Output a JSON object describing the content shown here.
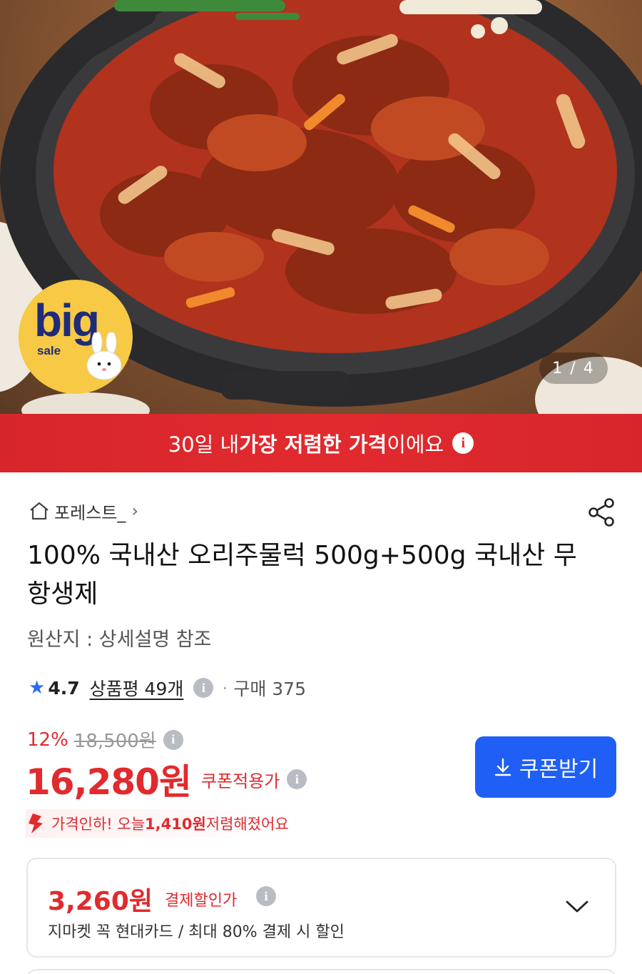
{
  "hero": {
    "counter": "1 / 4",
    "badge_big": "big",
    "badge_sale": "sale"
  },
  "banner": {
    "text_pre": "30일 내 ",
    "text_bold": "가장 저렴한 가격",
    "text_post": "이에요",
    "info": "i"
  },
  "store": {
    "name": "포레스트_",
    "chevron": "›"
  },
  "product": {
    "title": "100% 국내산 오리주물럭 500g+500g 국내산 무항생제",
    "origin": "원산지 : 상세설명 참조"
  },
  "rating": {
    "star": "★",
    "score": "4.7",
    "reviews": "상품평 49개",
    "info": "i",
    "dot": "·",
    "purchases": "구매 375"
  },
  "pricing": {
    "discount": "12%",
    "original": "18,500원",
    "info": "i",
    "price": "16,280원",
    "coupon_label": "쿠폰적용가",
    "coupon_button": "쿠폰받기",
    "drop_pre": "가격인하! 오늘 ",
    "drop_amount": "1,410원",
    "drop_post": " 저렴해졌어요"
  },
  "payment": {
    "price": "3,260원",
    "label": "결제할인가",
    "info": "i",
    "desc": "지마켓 꼭 현대카드 / 최대 80% 결제 시 할인"
  },
  "colors": {
    "accent_red": "#e12a2e",
    "accent_blue": "#1f5ff5",
    "badge_yellow": "#f7c944"
  }
}
